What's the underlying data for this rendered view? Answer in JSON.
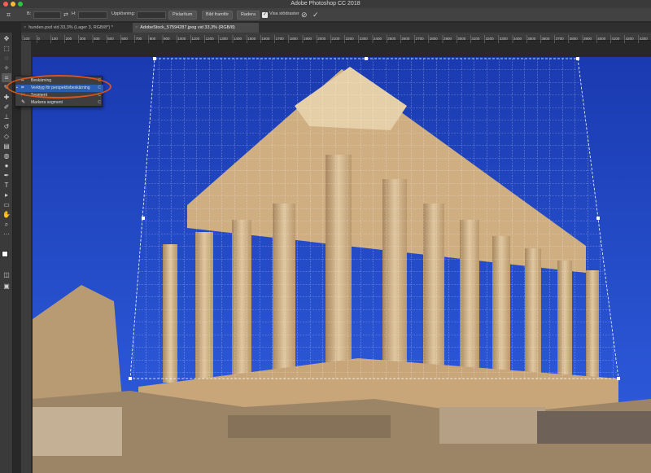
{
  "app": {
    "title": "Adobe Photoshop CC 2018"
  },
  "options_bar": {
    "b_label": "B:",
    "h_label": "H:",
    "resolution_label": "Upplösning:",
    "units_value": "Pixlar/tum",
    "front_button": "Bild framför",
    "clear_button": "Radera",
    "show_guides_label": "Visa stödraster",
    "cancel_icon": "cancel-circle-icon",
    "commit_icon": "checkmark-icon"
  },
  "tabs": [
    {
      "label": "hunden.psd vid 33,3% (Lager 3, RGB/8*) *",
      "active": false
    },
    {
      "label": "AdobeStock_57594287.jpeg vid 33,3% (RGB/8)",
      "active": true
    }
  ],
  "ruler": {
    "ticks": [
      "100",
      "0",
      "100",
      "200",
      "300",
      "400",
      "500",
      "600",
      "700",
      "800",
      "900",
      "1000",
      "1100",
      "1200",
      "1300",
      "1400",
      "1500",
      "1600",
      "1700",
      "1800",
      "1900",
      "2000",
      "2100",
      "2200",
      "2300",
      "2400",
      "2500",
      "2600",
      "2700",
      "2800",
      "2900",
      "3000",
      "3100",
      "3200",
      "3300",
      "3400",
      "3500",
      "3600",
      "3700",
      "3800",
      "3900",
      "4000",
      "4100",
      "4200",
      "4300"
    ]
  },
  "flyout": {
    "items": [
      {
        "label": "Beskärning",
        "key": "C",
        "icon": "crop-icon",
        "highlighted": false
      },
      {
        "label": "Verktyg för perspektivbeskärning",
        "key": "C",
        "icon": "perspective-crop-icon",
        "highlighted": true
      },
      {
        "label": "Segment",
        "key": "C",
        "icon": "slice-icon",
        "highlighted": false
      },
      {
        "label": "Markera segment",
        "key": "C",
        "icon": "slice-select-icon",
        "highlighted": false
      }
    ]
  },
  "colors": {
    "sky": "#1e44c0",
    "annotation": "#d9541b",
    "highlight": "#2a5db0"
  }
}
